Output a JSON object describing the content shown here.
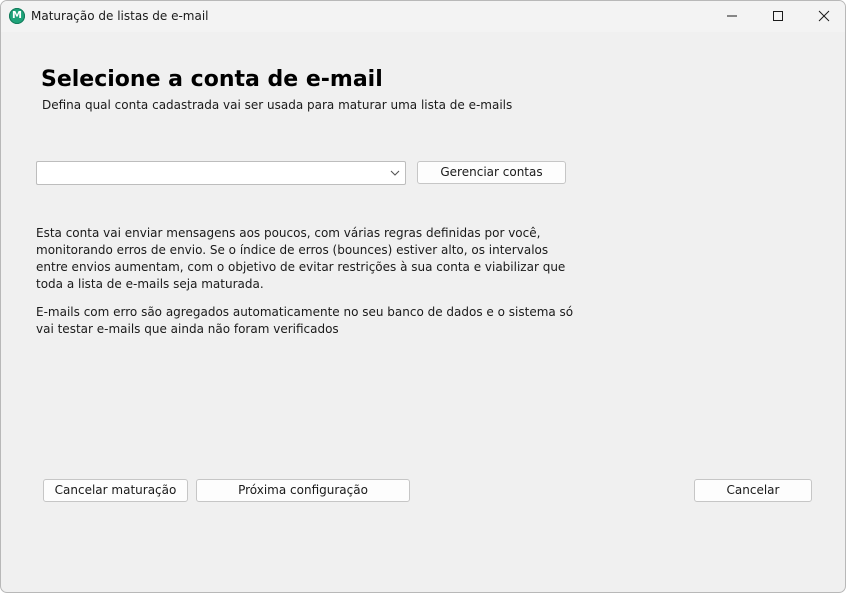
{
  "window": {
    "title": "Maturação de listas de e-mail",
    "icon_letter": "M",
    "controls": {
      "minimize": "minimize-icon",
      "maximize": "maximize-icon",
      "close": "close-icon"
    }
  },
  "header": {
    "title": "Selecione a conta de e-mail",
    "subtitle": "Defina qual conta cadastrada vai ser usada para maturar uma lista de e-mails"
  },
  "account": {
    "selected_value": "",
    "manage_button": "Gerenciar contas"
  },
  "description": {
    "paragraph1": [
      "Esta conta vai enviar mensagens aos poucos, com várias regras definidas por você,",
      "monitorando erros de envio. Se o índice de erros (bounces) estiver alto, os intervalos",
      "entre envios aumentam, com o objetivo de evitar restrições à sua conta e viabilizar que",
      "toda a lista de e-mails seja maturada."
    ],
    "paragraph2": [
      "E-mails com erro são agregados automaticamente no seu banco de dados e o sistema só",
      "vai testar e-mails que ainda não foram verificados"
    ]
  },
  "footer": {
    "cancel_maturation": "Cancelar maturação",
    "next_config": "Próxima configuração",
    "cancel": "Cancelar"
  }
}
